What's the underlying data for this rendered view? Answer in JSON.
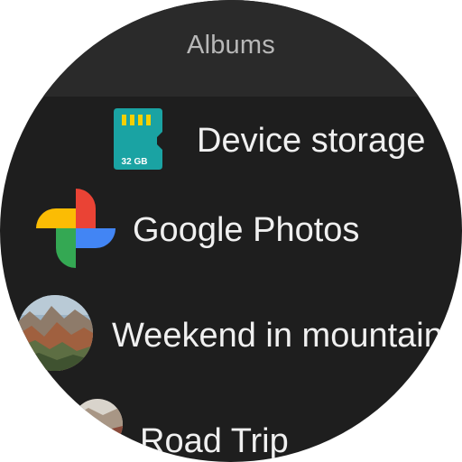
{
  "header": {
    "title": "Albums"
  },
  "albums": [
    {
      "label": "Device storage",
      "icon": "sd-card-icon",
      "card_text": "32 GB"
    },
    {
      "label": "Google Photos",
      "icon": "google-photos-icon"
    },
    {
      "label": "Weekend in mountain",
      "icon": "mountain-thumbnail"
    },
    {
      "label": "Road Trip",
      "icon": "road-trip-thumbnail"
    }
  ],
  "colors": {
    "background": "#1e1e1e",
    "header_background": "#2a2a2a",
    "header_text": "#b8b8b8",
    "item_text": "#f0f0f0",
    "sd_card": "#1aa3a3",
    "google_red": "#ea4335",
    "google_yellow": "#fbbc04",
    "google_green": "#34a853",
    "google_blue": "#4285f4"
  }
}
